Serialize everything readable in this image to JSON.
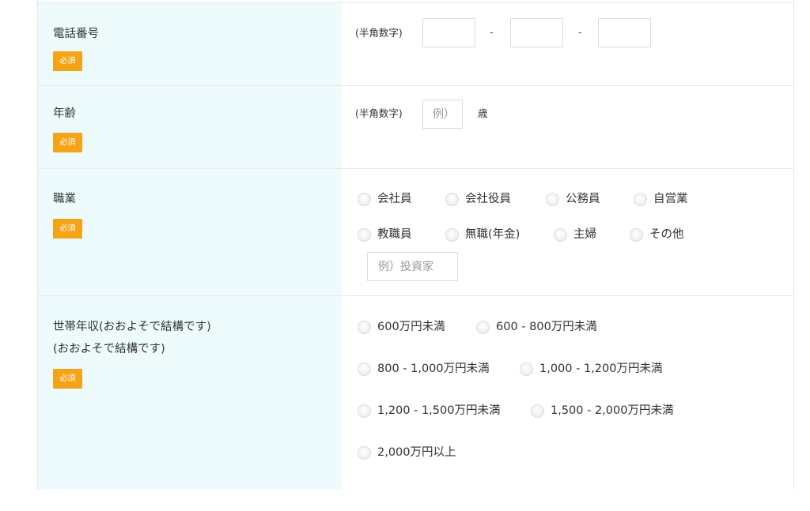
{
  "form": {
    "phone": {
      "label": "電話番号",
      "required": "必須",
      "hint": "(半角数字)",
      "separators": [
        "-",
        "-"
      ]
    },
    "age": {
      "label": "年齢",
      "required": "必須",
      "hint": "(半角数字)",
      "placeholder": "例）",
      "unit": "歳"
    },
    "occupation": {
      "label": "職業",
      "required": "必須",
      "options": [
        "会社員",
        "会社役員",
        "公務員",
        "自営業",
        "教職員",
        "無職(年金)",
        "主婦",
        "その他"
      ],
      "other_placeholder": "例）投資家"
    },
    "income": {
      "label_line1": "世帯年収(おおよそで結構です)",
      "label_line2": "(おおよそで結構です)",
      "required": "必須",
      "options": [
        "600万円未満",
        "600 - 800万円未満",
        "800 - 1,000万円未満",
        "1,000 - 1,200万円未満",
        "1,200 - 1,500万円未満",
        "1,500 - 2,000万円未満",
        "2,000万円以上"
      ]
    }
  },
  "colors": {
    "label_bg": "#eefbfd",
    "required_badge": "#f5a417",
    "border": "#e4e9ec"
  }
}
